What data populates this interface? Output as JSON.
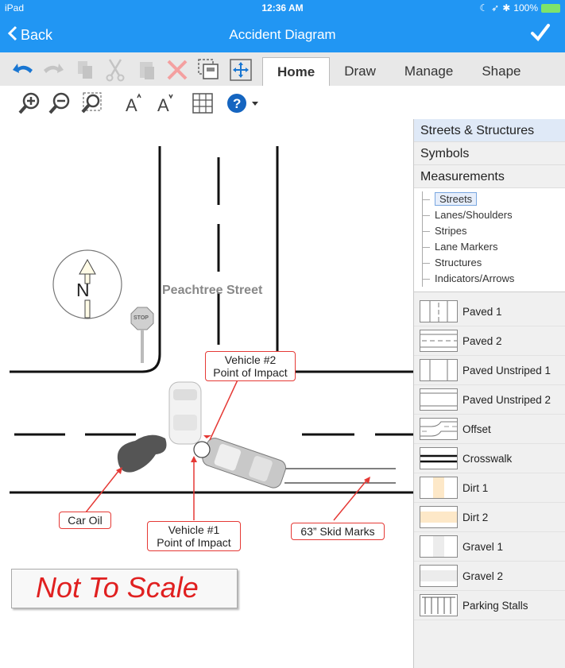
{
  "status_bar": {
    "device": "iPad",
    "time": "12:36 AM",
    "battery": "100%"
  },
  "nav": {
    "back_label": "Back",
    "title": "Accident Diagram"
  },
  "tabs": [
    {
      "label": "Home",
      "active": true
    },
    {
      "label": "Draw",
      "active": false
    },
    {
      "label": "Manage",
      "active": false
    },
    {
      "label": "Shape",
      "active": false
    }
  ],
  "diagram": {
    "street_name": "Peachtree Street",
    "compass_label": "N",
    "stop_sign_text": "STOP",
    "callouts": {
      "vehicle2": [
        "Vehicle #2",
        "Point of Impact"
      ],
      "vehicle1": [
        "Vehicle #1",
        "Point of Impact"
      ],
      "car_oil": "Car Oil",
      "skid": "63” Skid Marks"
    },
    "not_to_scale": "Not To Scale"
  },
  "panel": {
    "categories": [
      "Streets & Structures",
      "Symbols",
      "Measurements"
    ],
    "tree": [
      "Streets",
      "Lanes/Shoulders",
      "Stripes",
      "Lane Markers",
      "Structures",
      "Indicators/Arrows"
    ],
    "shapes": [
      "Paved 1",
      "Paved 2",
      "Paved Unstriped 1",
      "Paved Unstriped 2",
      "Offset",
      "Crosswalk",
      "Dirt 1",
      "Dirt 2",
      "Gravel 1",
      "Gravel 2",
      "Parking Stalls"
    ]
  },
  "colors": {
    "accent": "#2196f3",
    "callout_border": "#e53935",
    "not_to_scale": "#e02020"
  }
}
